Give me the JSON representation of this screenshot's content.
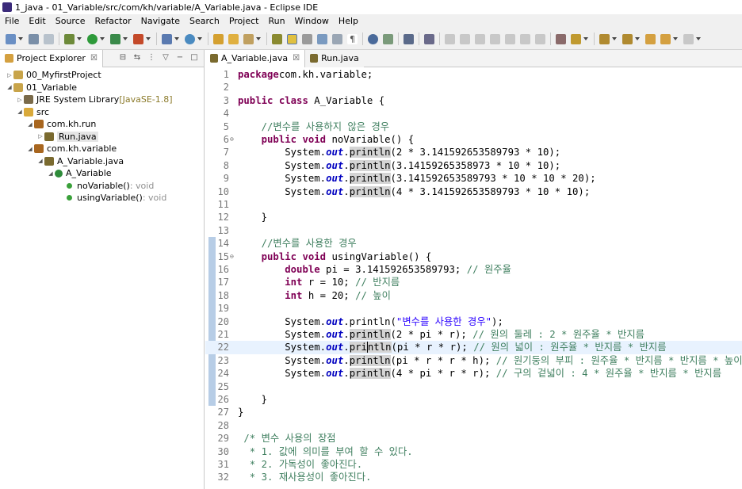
{
  "window": {
    "title": "1_java - 01_Variable/src/com/kh/variable/A_Variable.java - Eclipse IDE"
  },
  "menu": [
    "File",
    "Edit",
    "Source",
    "Refactor",
    "Navigate",
    "Search",
    "Project",
    "Run",
    "Window",
    "Help"
  ],
  "explorer": {
    "tab_label": "Project Explorer",
    "tree": [
      {
        "label": "00_MyfirstProject",
        "depth": 0,
        "twisty": "▷",
        "icon": "project-folder-icon",
        "color": "#c8a44a"
      },
      {
        "label": "01_Variable",
        "depth": 0,
        "twisty": "◢",
        "icon": "project-folder-icon",
        "color": "#c8a44a"
      },
      {
        "label": "JRE System Library",
        "decor": " [JavaSE-1.8]",
        "depth": 1,
        "twisty": "▷",
        "icon": "library-icon",
        "color": "#7a6a4a"
      },
      {
        "label": "src",
        "depth": 1,
        "twisty": "◢",
        "icon": "source-folder-icon",
        "color": "#d9a93a"
      },
      {
        "label": "com.kh.run",
        "depth": 2,
        "twisty": "◢",
        "icon": "package-icon",
        "color": "#a8661f"
      },
      {
        "label": "Run.java",
        "depth": 3,
        "twisty": "▷",
        "icon": "java-file-icon",
        "color": "#7a6a2f",
        "selected": true
      },
      {
        "label": "com.kh.variable",
        "depth": 2,
        "twisty": "◢",
        "icon": "package-icon",
        "color": "#a8661f"
      },
      {
        "label": "A_Variable.java",
        "depth": 3,
        "twisty": "◢",
        "icon": "java-file-icon",
        "color": "#7a6a2f"
      },
      {
        "label": "A_Variable",
        "depth": 4,
        "twisty": "◢",
        "icon": "class-icon",
        "color": "#2e8b3a"
      },
      {
        "label": "noVariable()",
        "ret": " : void",
        "depth": 5,
        "twisty": "",
        "icon": "method-icon",
        "color": "#3aa03a"
      },
      {
        "label": "usingVariable()",
        "ret": " : void",
        "depth": 5,
        "twisty": "",
        "icon": "method-icon",
        "color": "#3aa03a"
      }
    ]
  },
  "editor": {
    "tabs": [
      {
        "label": "A_Variable.java",
        "active": true,
        "close": "☒"
      },
      {
        "label": "Run.java",
        "active": false,
        "close": ""
      }
    ],
    "current_line": 22,
    "lines": [
      {
        "n": "1",
        "fold": "",
        "segs": [
          [
            "kw",
            "package"
          ],
          [
            "",
            "com.kh.variable;"
          ]
        ]
      },
      {
        "n": "2",
        "fold": "",
        "segs": []
      },
      {
        "n": "3",
        "fold": "",
        "segs": [
          [
            "kw",
            "public"
          ],
          [
            "",
            " "
          ],
          [
            "kw",
            "class"
          ],
          [
            "",
            " A_Variable {"
          ]
        ]
      },
      {
        "n": "4",
        "fold": "",
        "segs": []
      },
      {
        "n": "5",
        "fold": "",
        "segs": [
          [
            "",
            "    "
          ],
          [
            "cm",
            "//변수를 사용하지 않은 경우"
          ]
        ]
      },
      {
        "n": "6",
        "fold": "⊖",
        "segs": [
          [
            "",
            "    "
          ],
          [
            "kw",
            "public"
          ],
          [
            "",
            " "
          ],
          [
            "kw",
            "void"
          ],
          [
            "",
            " noVariable() {"
          ]
        ]
      },
      {
        "n": "7",
        "fold": "",
        "segs": [
          [
            "",
            "        System."
          ],
          [
            "fld",
            "out"
          ],
          [
            "",
            "."
          ],
          [
            "hl",
            "println"
          ],
          [
            "",
            "(2 * 3.141592653589793 * 10);"
          ]
        ]
      },
      {
        "n": "8",
        "fold": "",
        "segs": [
          [
            "",
            "        System."
          ],
          [
            "fld",
            "out"
          ],
          [
            "",
            "."
          ],
          [
            "hl",
            "println"
          ],
          [
            "",
            "(3.14159265358973 * 10 * 10);"
          ]
        ]
      },
      {
        "n": "9",
        "fold": "",
        "segs": [
          [
            "",
            "        System."
          ],
          [
            "fld",
            "out"
          ],
          [
            "",
            "."
          ],
          [
            "hl",
            "println"
          ],
          [
            "",
            "(3.141592653589793 * 10 * 10 * 20);"
          ]
        ]
      },
      {
        "n": "10",
        "fold": "",
        "segs": [
          [
            "",
            "        System."
          ],
          [
            "fld",
            "out"
          ],
          [
            "",
            "."
          ],
          [
            "hl",
            "println"
          ],
          [
            "",
            "(4 * 3.141592653589793 * 10 * 10);"
          ]
        ]
      },
      {
        "n": "11",
        "fold": "",
        "segs": []
      },
      {
        "n": "12",
        "fold": "",
        "segs": [
          [
            "",
            "    }"
          ]
        ]
      },
      {
        "n": "13",
        "fold": "",
        "segs": []
      },
      {
        "n": "14",
        "fold": "",
        "segs": [
          [
            "",
            "    "
          ],
          [
            "cm",
            "//변수를 사용한 경우"
          ]
        ]
      },
      {
        "n": "15",
        "fold": "⊖",
        "segs": [
          [
            "",
            "    "
          ],
          [
            "kw",
            "public"
          ],
          [
            "",
            " "
          ],
          [
            "kw",
            "void"
          ],
          [
            "",
            " usingVariable() {"
          ]
        ]
      },
      {
        "n": "16",
        "fold": "",
        "segs": [
          [
            "",
            "        "
          ],
          [
            "kw",
            "double"
          ],
          [
            "",
            " pi = 3.141592653589793; "
          ],
          [
            "cm",
            "// 원주율"
          ]
        ]
      },
      {
        "n": "17",
        "fold": "",
        "segs": [
          [
            "",
            "        "
          ],
          [
            "kw",
            "int"
          ],
          [
            "",
            " r = 10; "
          ],
          [
            "cm",
            "// 반지름"
          ]
        ]
      },
      {
        "n": "18",
        "fold": "",
        "segs": [
          [
            "",
            "        "
          ],
          [
            "kw",
            "int"
          ],
          [
            "",
            " h = 20; "
          ],
          [
            "cm",
            "// 높이"
          ]
        ]
      },
      {
        "n": "19",
        "fold": "",
        "segs": []
      },
      {
        "n": "20",
        "fold": "",
        "segs": [
          [
            "",
            "        System."
          ],
          [
            "fld",
            "out"
          ],
          [
            "",
            ".println("
          ],
          [
            "str",
            "\"변수를 사용한 경우\""
          ],
          [
            "",
            ");"
          ]
        ]
      },
      {
        "n": "21",
        "fold": "",
        "segs": [
          [
            "",
            "        System."
          ],
          [
            "fld",
            "out"
          ],
          [
            "",
            "."
          ],
          [
            "hl",
            "println"
          ],
          [
            "",
            "(2 * pi * r); "
          ],
          [
            "cm",
            "// 원의 둘레 : 2 * 원주율 * 반지름"
          ]
        ]
      },
      {
        "n": "22",
        "fold": "",
        "segs": [
          [
            "",
            "        System."
          ],
          [
            "fld",
            "out"
          ],
          [
            "",
            "."
          ],
          [
            "hl",
            "pri"
          ],
          [
            "hl cursor",
            "ntln"
          ],
          [
            "",
            "(pi * r * r); "
          ],
          [
            "cm",
            "// 원의 넓이 : 원주율 * 반지름 * 반지름"
          ]
        ]
      },
      {
        "n": "23",
        "fold": "",
        "segs": [
          [
            "",
            "        System."
          ],
          [
            "fld",
            "out"
          ],
          [
            "",
            "."
          ],
          [
            "hl",
            "println"
          ],
          [
            "",
            "(pi * r * r * h); "
          ],
          [
            "cm",
            "// 원기둥의 부피 : 원주율 * 반지름 * 반지름 * 높이"
          ]
        ]
      },
      {
        "n": "24",
        "fold": "",
        "segs": [
          [
            "",
            "        System."
          ],
          [
            "fld",
            "out"
          ],
          [
            "",
            "."
          ],
          [
            "hl",
            "println"
          ],
          [
            "",
            "(4 * pi * r * r); "
          ],
          [
            "cm",
            "// 구의 겉넓이 : 4 * 원주율 * 반지름 * 반지름"
          ]
        ]
      },
      {
        "n": "25",
        "fold": "",
        "segs": []
      },
      {
        "n": "26",
        "fold": "",
        "segs": [
          [
            "",
            "    }"
          ]
        ]
      },
      {
        "n": "27",
        "fold": "",
        "segs": [
          [
            "",
            "}"
          ]
        ]
      },
      {
        "n": "28",
        "fold": "",
        "segs": []
      },
      {
        "n": "29",
        "fold": "",
        "segs": [
          [
            "cm",
            " /* 변수 사용의 장점"
          ]
        ]
      },
      {
        "n": "30",
        "fold": "",
        "segs": [
          [
            "cm",
            "  * 1. 값에 의미를 부여 할 수 있다."
          ]
        ]
      },
      {
        "n": "31",
        "fold": "",
        "segs": [
          [
            "cm",
            "  * 2. 가독성이 좋아진다."
          ]
        ]
      },
      {
        "n": "32",
        "fold": "",
        "segs": [
          [
            "cm",
            "  * 3. 재사용성이 좋아진다."
          ]
        ]
      }
    ]
  },
  "colors": {
    "keyword": "#7f0055",
    "comment": "#3f7f5f",
    "field": "#0000c0",
    "string": "#2a00ff",
    "current_line": "#e8f2fe",
    "overview": "#b7cde6"
  }
}
